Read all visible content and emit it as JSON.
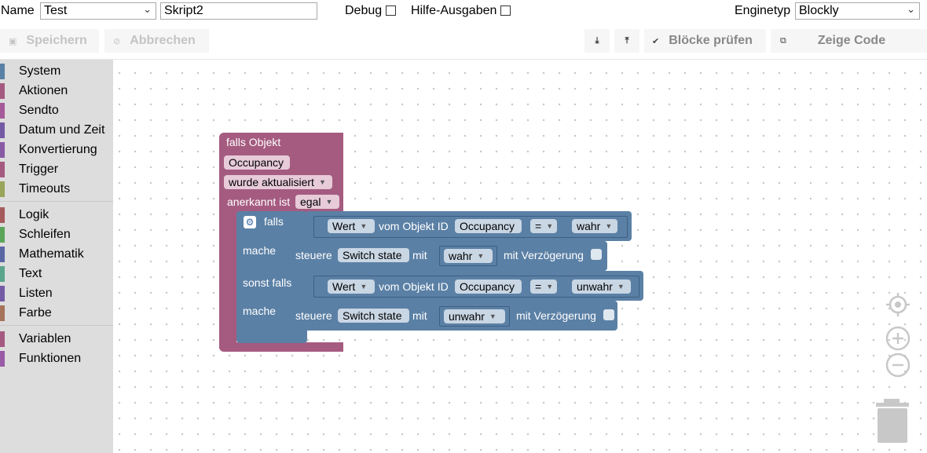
{
  "header": {
    "name_label": "Name",
    "folder_value": "Test",
    "script_name": "Skript2",
    "debug_label": "Debug",
    "help_label": "Hilfe-Ausgaben",
    "engine_label": "Enginetyp",
    "engine_value": "Blockly"
  },
  "toolbar": {
    "save_label": "Speichern",
    "cancel_label": "Abbrechen",
    "check_label": "Blöcke prüfen",
    "code_label": "Zeige Code"
  },
  "sidebar": {
    "categories": [
      {
        "label": "System",
        "color": "#5b80a5"
      },
      {
        "label": "Aktionen",
        "color": "#a55b80"
      },
      {
        "label": "Sendto",
        "color": "#a55b99"
      },
      {
        "label": "Datum und Zeit",
        "color": "#745ba5"
      },
      {
        "label": "Konvertierung",
        "color": "#8a5ba5"
      },
      {
        "label": "Trigger",
        "color": "#a55b80"
      },
      {
        "label": "Timeouts",
        "color": "#99a55b"
      },
      {
        "label": "Logik",
        "color": "#a55b5b"
      },
      {
        "label": "Schleifen",
        "color": "#5ba55b"
      },
      {
        "label": "Mathematik",
        "color": "#5b67a5"
      },
      {
        "label": "Text",
        "color": "#5ba58c"
      },
      {
        "label": "Listen",
        "color": "#745ba5"
      },
      {
        "label": "Farbe",
        "color": "#a5745b"
      },
      {
        "label": "Variablen",
        "color": "#a55b80"
      },
      {
        "label": "Funktionen",
        "color": "#995ba5"
      }
    ]
  },
  "workspace": {
    "trigger_block": {
      "title": "falls Objekt",
      "object": "Occupancy",
      "event": "wurde aktualisiert",
      "ack_label": "anerkannt ist",
      "ack_value": "egal"
    },
    "if_block": {
      "if_label": "falls",
      "do_label": "mache",
      "elseif_label": "sonst falls",
      "do2_label": "mache",
      "cond1": {
        "attr": "Wert",
        "mid": "vom Objekt ID",
        "obj": "Occupancy",
        "op": "=",
        "value": "wahr"
      },
      "action1": {
        "verb": "steuere",
        "target": "Switch state",
        "with": "mit",
        "value": "wahr",
        "delay": "mit Verzögerung"
      },
      "cond2": {
        "attr": "Wert",
        "mid": "vom Objekt ID",
        "obj": "Occupancy",
        "op": "=",
        "value": "unwahr"
      },
      "action2": {
        "verb": "steuere",
        "target": "Switch state",
        "with": "mit",
        "value": "unwahr",
        "delay": "mit Verzögerung"
      }
    }
  }
}
